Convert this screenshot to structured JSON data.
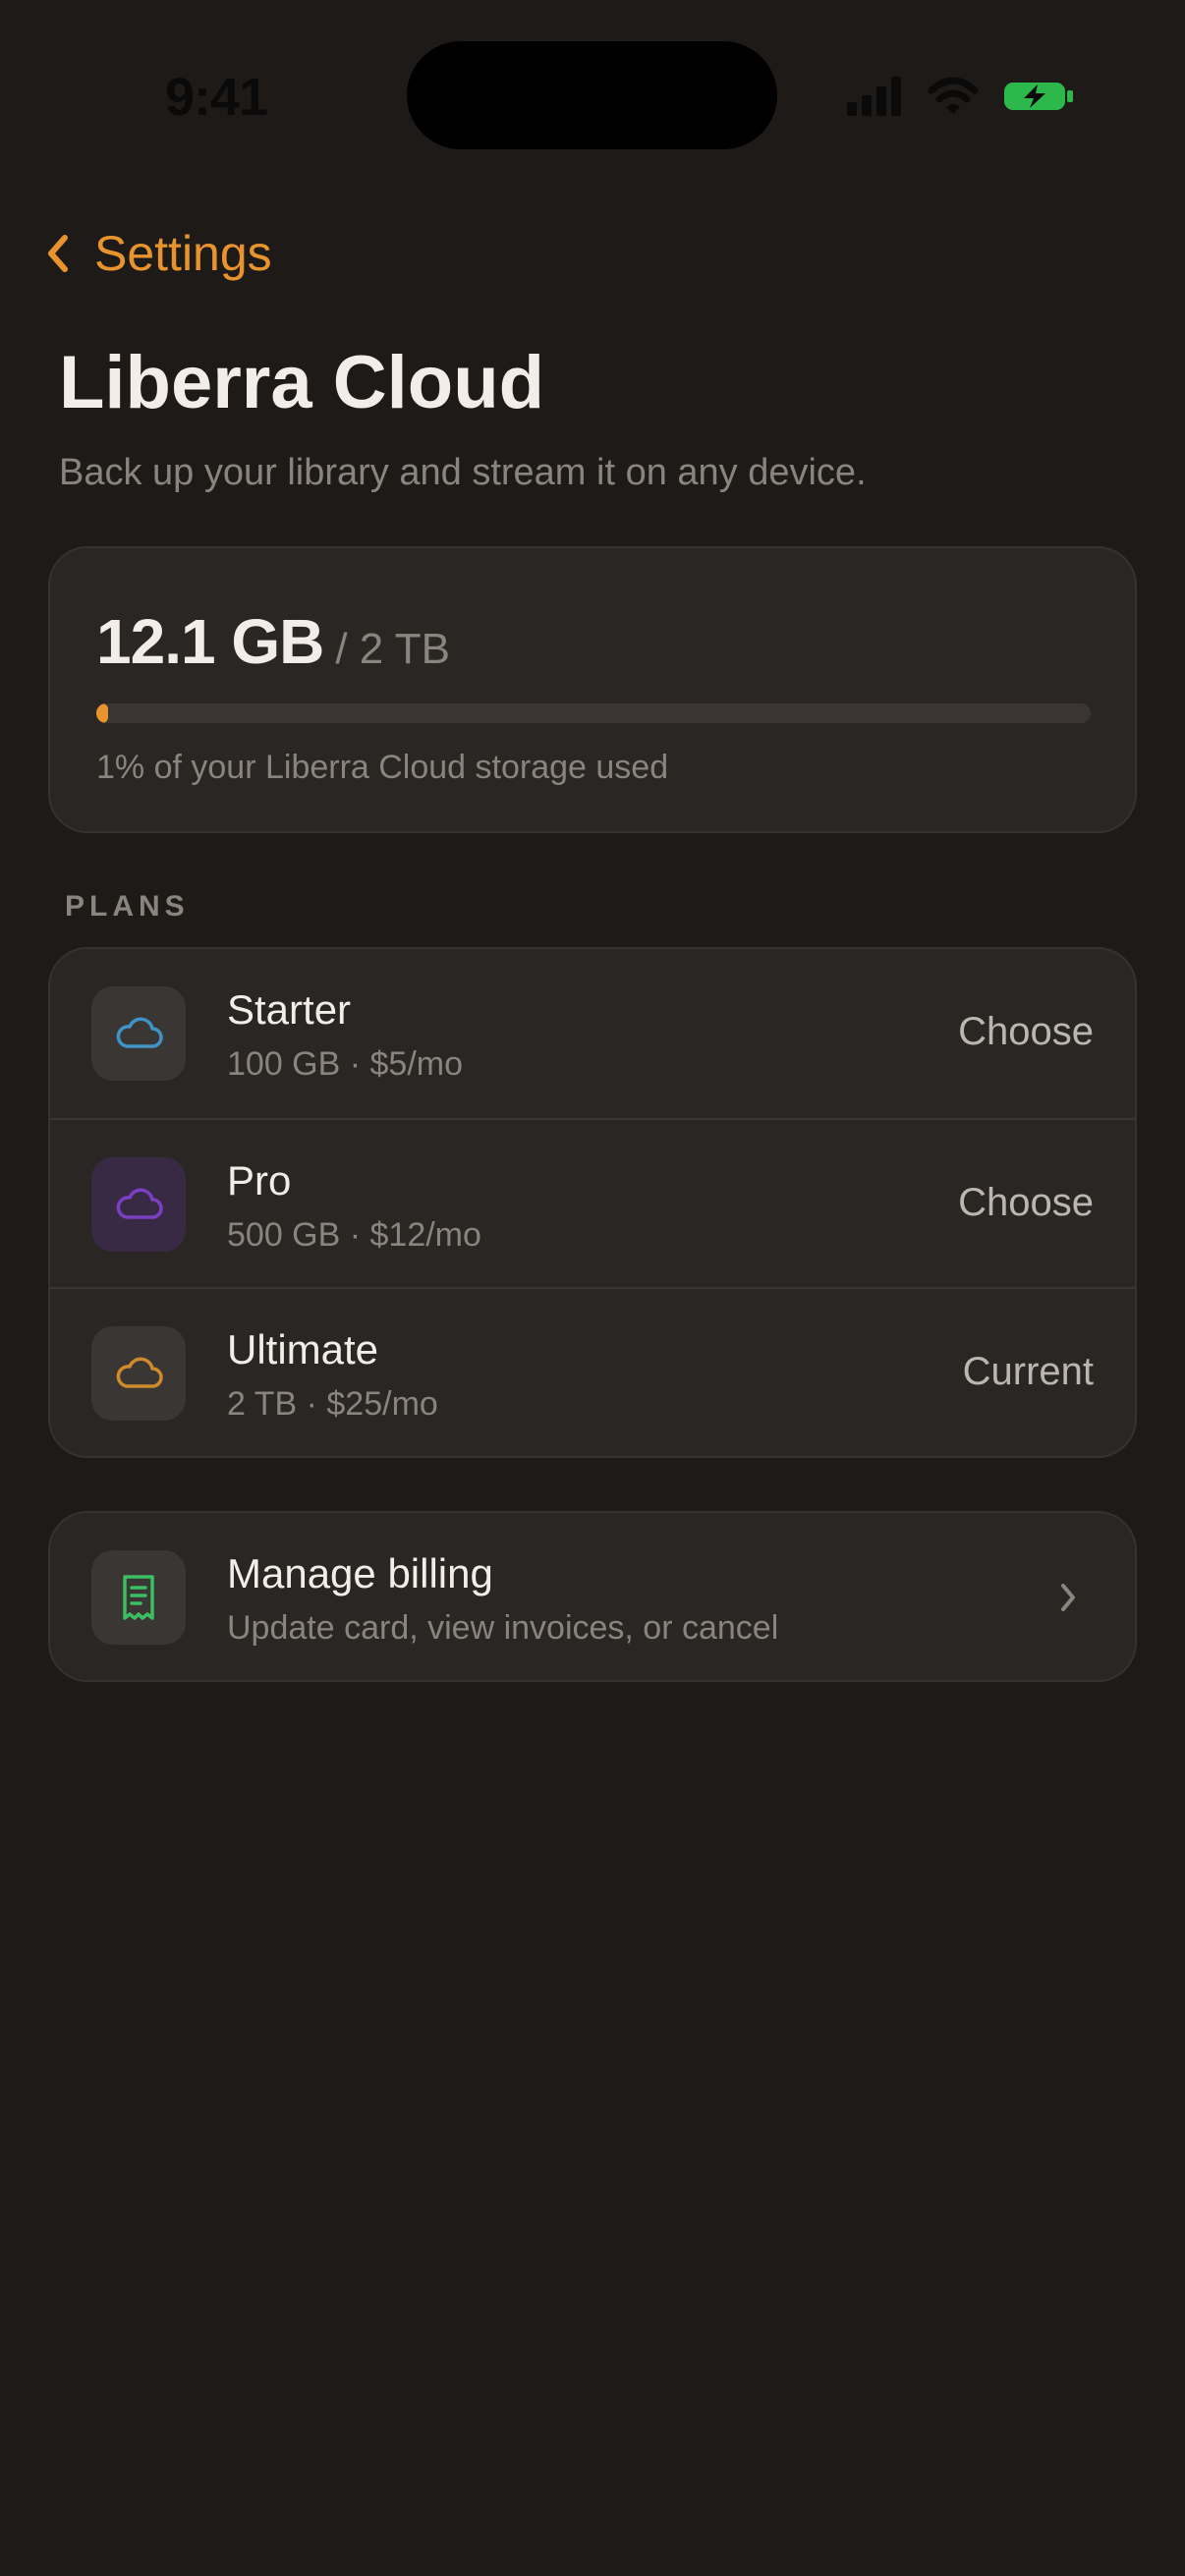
{
  "status_bar": {
    "time": "9:41"
  },
  "nav": {
    "back_label": "Settings"
  },
  "header": {
    "title": "Liberra Cloud",
    "subtitle": "Back up your library and stream it on any device."
  },
  "storage": {
    "used": "12.1 GB",
    "total": "/ 2 TB",
    "percent_used": 1,
    "caption": "1% of your Liberra Cloud storage used",
    "accent_color": "#e8942e"
  },
  "plans": {
    "section_label": "PLANS",
    "items": [
      {
        "name": "Starter",
        "detail": "100 GB · $5/mo",
        "action": "Choose",
        "icon": "cloud-icon",
        "icon_color": "#3f93c8",
        "tile_color": "#3a3633"
      },
      {
        "name": "Pro",
        "detail": "500 GB · $12/mo",
        "action": "Choose",
        "icon": "cloud-icon",
        "icon_color": "#7b3fc4",
        "tile_color": "#382a44"
      },
      {
        "name": "Ultimate",
        "detail": "2 TB · $25/mo",
        "action": "Current",
        "icon": "cloud-icon",
        "icon_color": "#cf8a2c",
        "tile_color": "#3a3633"
      }
    ]
  },
  "billing": {
    "title": "Manage billing",
    "subtitle": "Update card, view invoices, or cancel",
    "icon": "receipt-icon",
    "icon_color": "#3bbf62"
  }
}
